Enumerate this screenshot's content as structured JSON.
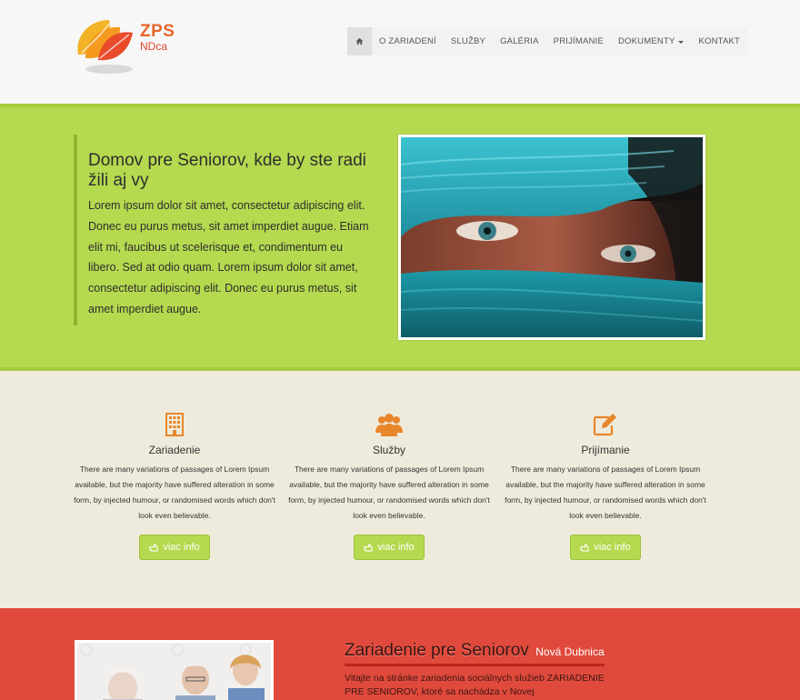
{
  "brand": {
    "line1": "ZPS",
    "line2": "NDca"
  },
  "nav": {
    "home_icon": "home-icon",
    "items": [
      "O ZARIADENÍ",
      "SLUŽBY",
      "GALÉRIA",
      "PRIJÍMANIE",
      "DOKUMENTY",
      "KONTAKT"
    ]
  },
  "hero": {
    "title": "Domov pre Seniorov, kde by ste radi žili aj vy",
    "body": "Lorem ipsum dolor sit amet, consectetur adipiscing elit. Donec eu purus metus, sit amet imperdiet augue. Etiam elit mi, faucibus ut scelerisque et, condimentum eu libero. Sed at odio quam. Lorem ipsum dolor sit amet, consectetur adipiscing elit. Donec eu purus metus, sit amet imperdiet augue."
  },
  "features": [
    {
      "icon": "building-icon",
      "title": "Zariadenie",
      "desc": "There are many variations of passages of Lorem Ipsum available, but the majority have suffered alteration in some form, by injected humour, or randomised words which don't look even believable.",
      "button": "viac info"
    },
    {
      "icon": "users-icon",
      "title": "Služby",
      "desc": "There are many variations of passages of Lorem Ipsum available, but the majority have suffered alteration in some form, by injected humour, or randomised words which don't look even believable.",
      "button": "viac info"
    },
    {
      "icon": "edit-icon",
      "title": "Prijímanie",
      "desc": "There are many variations of passages of Lorem Ipsum available, but the majority have suffered alteration in some form, by injected humour, or randomised words which don't look even believable.",
      "button": "viac info"
    }
  ],
  "about": {
    "title": "Zariadenie pre Seniorov",
    "subtitle": "Nová Dubnica",
    "body": "Vitajte na stránke zariadenia sociálnych služieb ZARIADENIE PRE SENIOROV, ktoré sa nachádza v Novej"
  },
  "colors": {
    "accent_green": "#b5d94f",
    "accent_orange": "#e8862a",
    "red_section": "#e04a3c",
    "feature_bg": "#efebdc"
  }
}
